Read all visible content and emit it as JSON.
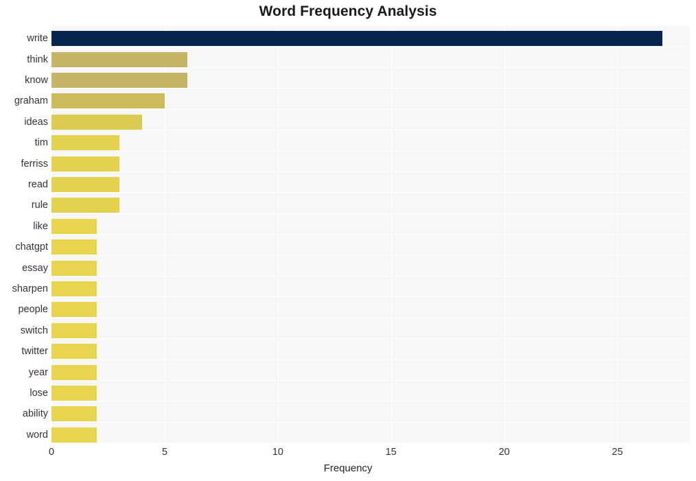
{
  "chart_data": {
    "type": "bar",
    "orientation": "horizontal",
    "title": "Word Frequency Analysis",
    "xlabel": "Frequency",
    "ylabel": "",
    "categories": [
      "write",
      "think",
      "know",
      "graham",
      "ideas",
      "tim",
      "ferriss",
      "read",
      "rule",
      "like",
      "chatgpt",
      "essay",
      "sharpen",
      "people",
      "switch",
      "twitter",
      "year",
      "lose",
      "ability",
      "word"
    ],
    "values": [
      27,
      6,
      6,
      5,
      4,
      3,
      3,
      3,
      3,
      2,
      2,
      2,
      2,
      2,
      2,
      2,
      2,
      2,
      2,
      2
    ],
    "xlim": [
      0,
      28.2
    ],
    "xticks": [
      0,
      5,
      10,
      15,
      20,
      25
    ],
    "xticklabels": [
      "0",
      "5",
      "10",
      "15",
      "20",
      "25"
    ],
    "grid": true,
    "grid_axis": "both",
    "legend": false,
    "bar_colors": [
      "#04254e",
      "#c4b464",
      "#c4b464",
      "#ccbb5a",
      "#dbcb52",
      "#e4d24e",
      "#e4d24e",
      "#e4d24e",
      "#e4d24e",
      "#e8d44d",
      "#e8d44d",
      "#e8d44d",
      "#e8d44d",
      "#e8d44d",
      "#e8d44d",
      "#e8d44d",
      "#e8d44d",
      "#e8d44d",
      "#e8d44d",
      "#e8d44d"
    ]
  },
  "style": {
    "plot_background": "#f7f7f7",
    "figure_background": "#ffffff",
    "gridline_color": "#ffffff",
    "text_color": "#333333",
    "accent_color": "#04254e"
  }
}
